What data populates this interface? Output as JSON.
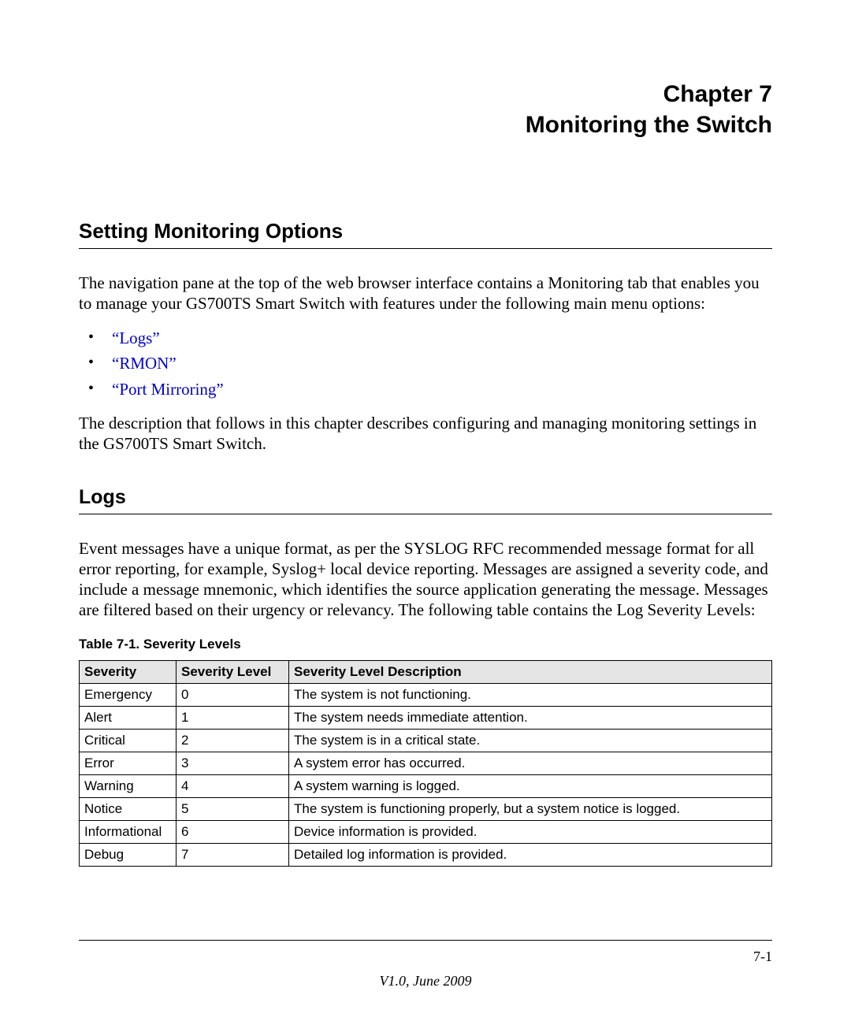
{
  "chapter": {
    "line1": "Chapter 7",
    "line2": "Monitoring the Switch"
  },
  "section": {
    "title": "Setting Monitoring Options",
    "intro": "The navigation pane at the top of the web browser interface contains a Monitoring tab that enables you to manage your GS700TS Smart Switch with features under the following main menu options:",
    "links": [
      "“Logs”",
      "“RMON”",
      "“Port Mirroring”"
    ],
    "outro": "The description that follows in this chapter describes configuring and managing monitoring settings in the GS700TS Smart Switch."
  },
  "logs": {
    "title": "Logs",
    "intro": "Event messages have a unique format, as per the SYSLOG RFC recommended message format for all error reporting, for example, Syslog+ local device reporting. Messages are assigned a severity code, and include a message mnemonic, which identifies the source application generating the message. Messages are filtered based on their urgency or relevancy. The following table contains the Log Severity Levels:",
    "table_caption": "Table 7-1.   Severity Levels",
    "headers": {
      "severity": "Severity",
      "level": "Severity Level",
      "description": "Severity Level Description"
    },
    "rows": [
      {
        "severity": "Emergency",
        "level": "0",
        "description": "The system is not functioning."
      },
      {
        "severity": "Alert",
        "level": "1",
        "description": "The system needs immediate attention."
      },
      {
        "severity": "Critical",
        "level": "2",
        "description": "The system is in a critical state."
      },
      {
        "severity": "Error",
        "level": "3",
        "description": "A system error has occurred."
      },
      {
        "severity": "Warning",
        "level": "4",
        "description": "A system warning is logged."
      },
      {
        "severity": "Notice",
        "level": "5",
        "description": "The system is functioning properly, but a system notice is logged."
      },
      {
        "severity": "Informational",
        "level": "6",
        "description": "Device information is provided."
      },
      {
        "severity": "Debug",
        "level": "7",
        "description": "Detailed log information is provided."
      }
    ]
  },
  "footer": {
    "page_number": "7-1",
    "version": "V1.0, June 2009"
  }
}
